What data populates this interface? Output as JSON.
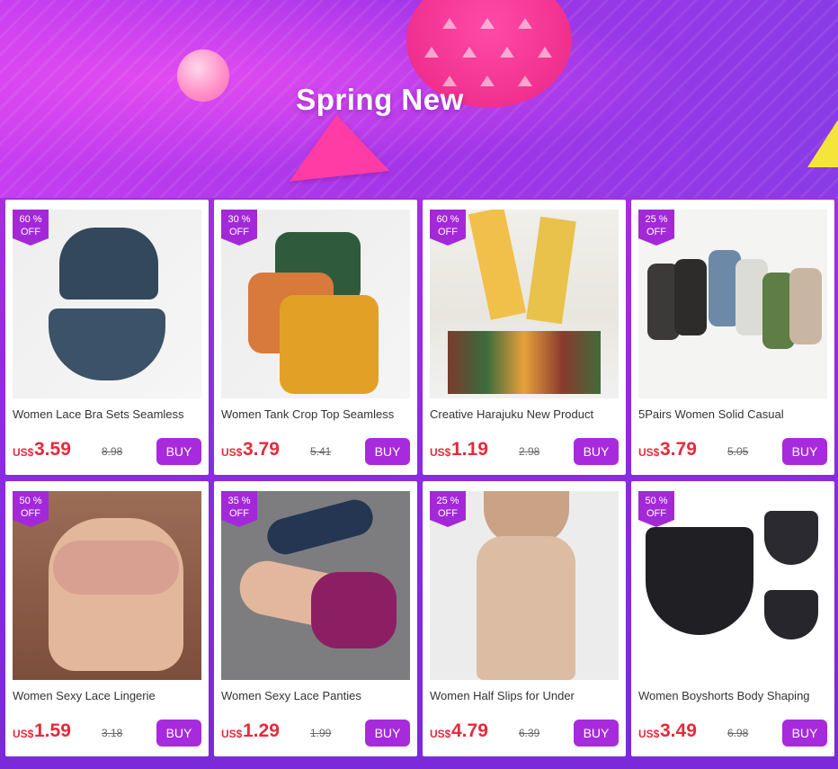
{
  "banner": {
    "title": "Spring New"
  },
  "products": [
    {
      "discount": "60 %",
      "off": "OFF",
      "title": "Women Lace Bra Sets Seamless",
      "currency": "US$",
      "price": "3.59",
      "old_price": "8.98",
      "buy": "BUY"
    },
    {
      "discount": "30 %",
      "off": "OFF",
      "title": "Women Tank Crop Top Seamless",
      "currency": "US$",
      "price": "3.79",
      "old_price": "5.41",
      "buy": "BUY"
    },
    {
      "discount": "60 %",
      "off": "OFF",
      "title": "Creative Harajuku New Product",
      "currency": "US$",
      "price": "1.19",
      "old_price": "2.98",
      "buy": "BUY"
    },
    {
      "discount": "25 %",
      "off": "OFF",
      "title": "5Pairs Women Solid Casual",
      "currency": "US$",
      "price": "3.79",
      "old_price": "5.05",
      "buy": "BUY"
    },
    {
      "discount": "50 %",
      "off": "OFF",
      "title": "Women Sexy Lace Lingerie",
      "currency": "US$",
      "price": "1.59",
      "old_price": "3.18",
      "buy": "BUY"
    },
    {
      "discount": "35 %",
      "off": "OFF",
      "title": "Women Sexy Lace Panties",
      "currency": "US$",
      "price": "1.29",
      "old_price": "1.99",
      "buy": "BUY"
    },
    {
      "discount": "25 %",
      "off": "OFF",
      "title": "Women Half Slips for Under",
      "currency": "US$",
      "price": "4.79",
      "old_price": "6.39",
      "buy": "BUY"
    },
    {
      "discount": "50 %",
      "off": "OFF",
      "title": "Women Boyshorts Body Shaping",
      "currency": "US$",
      "price": "3.49",
      "old_price": "6.98",
      "buy": "BUY"
    }
  ],
  "colors": {
    "accent": "#a72bdc",
    "price": "#e42a3c"
  }
}
